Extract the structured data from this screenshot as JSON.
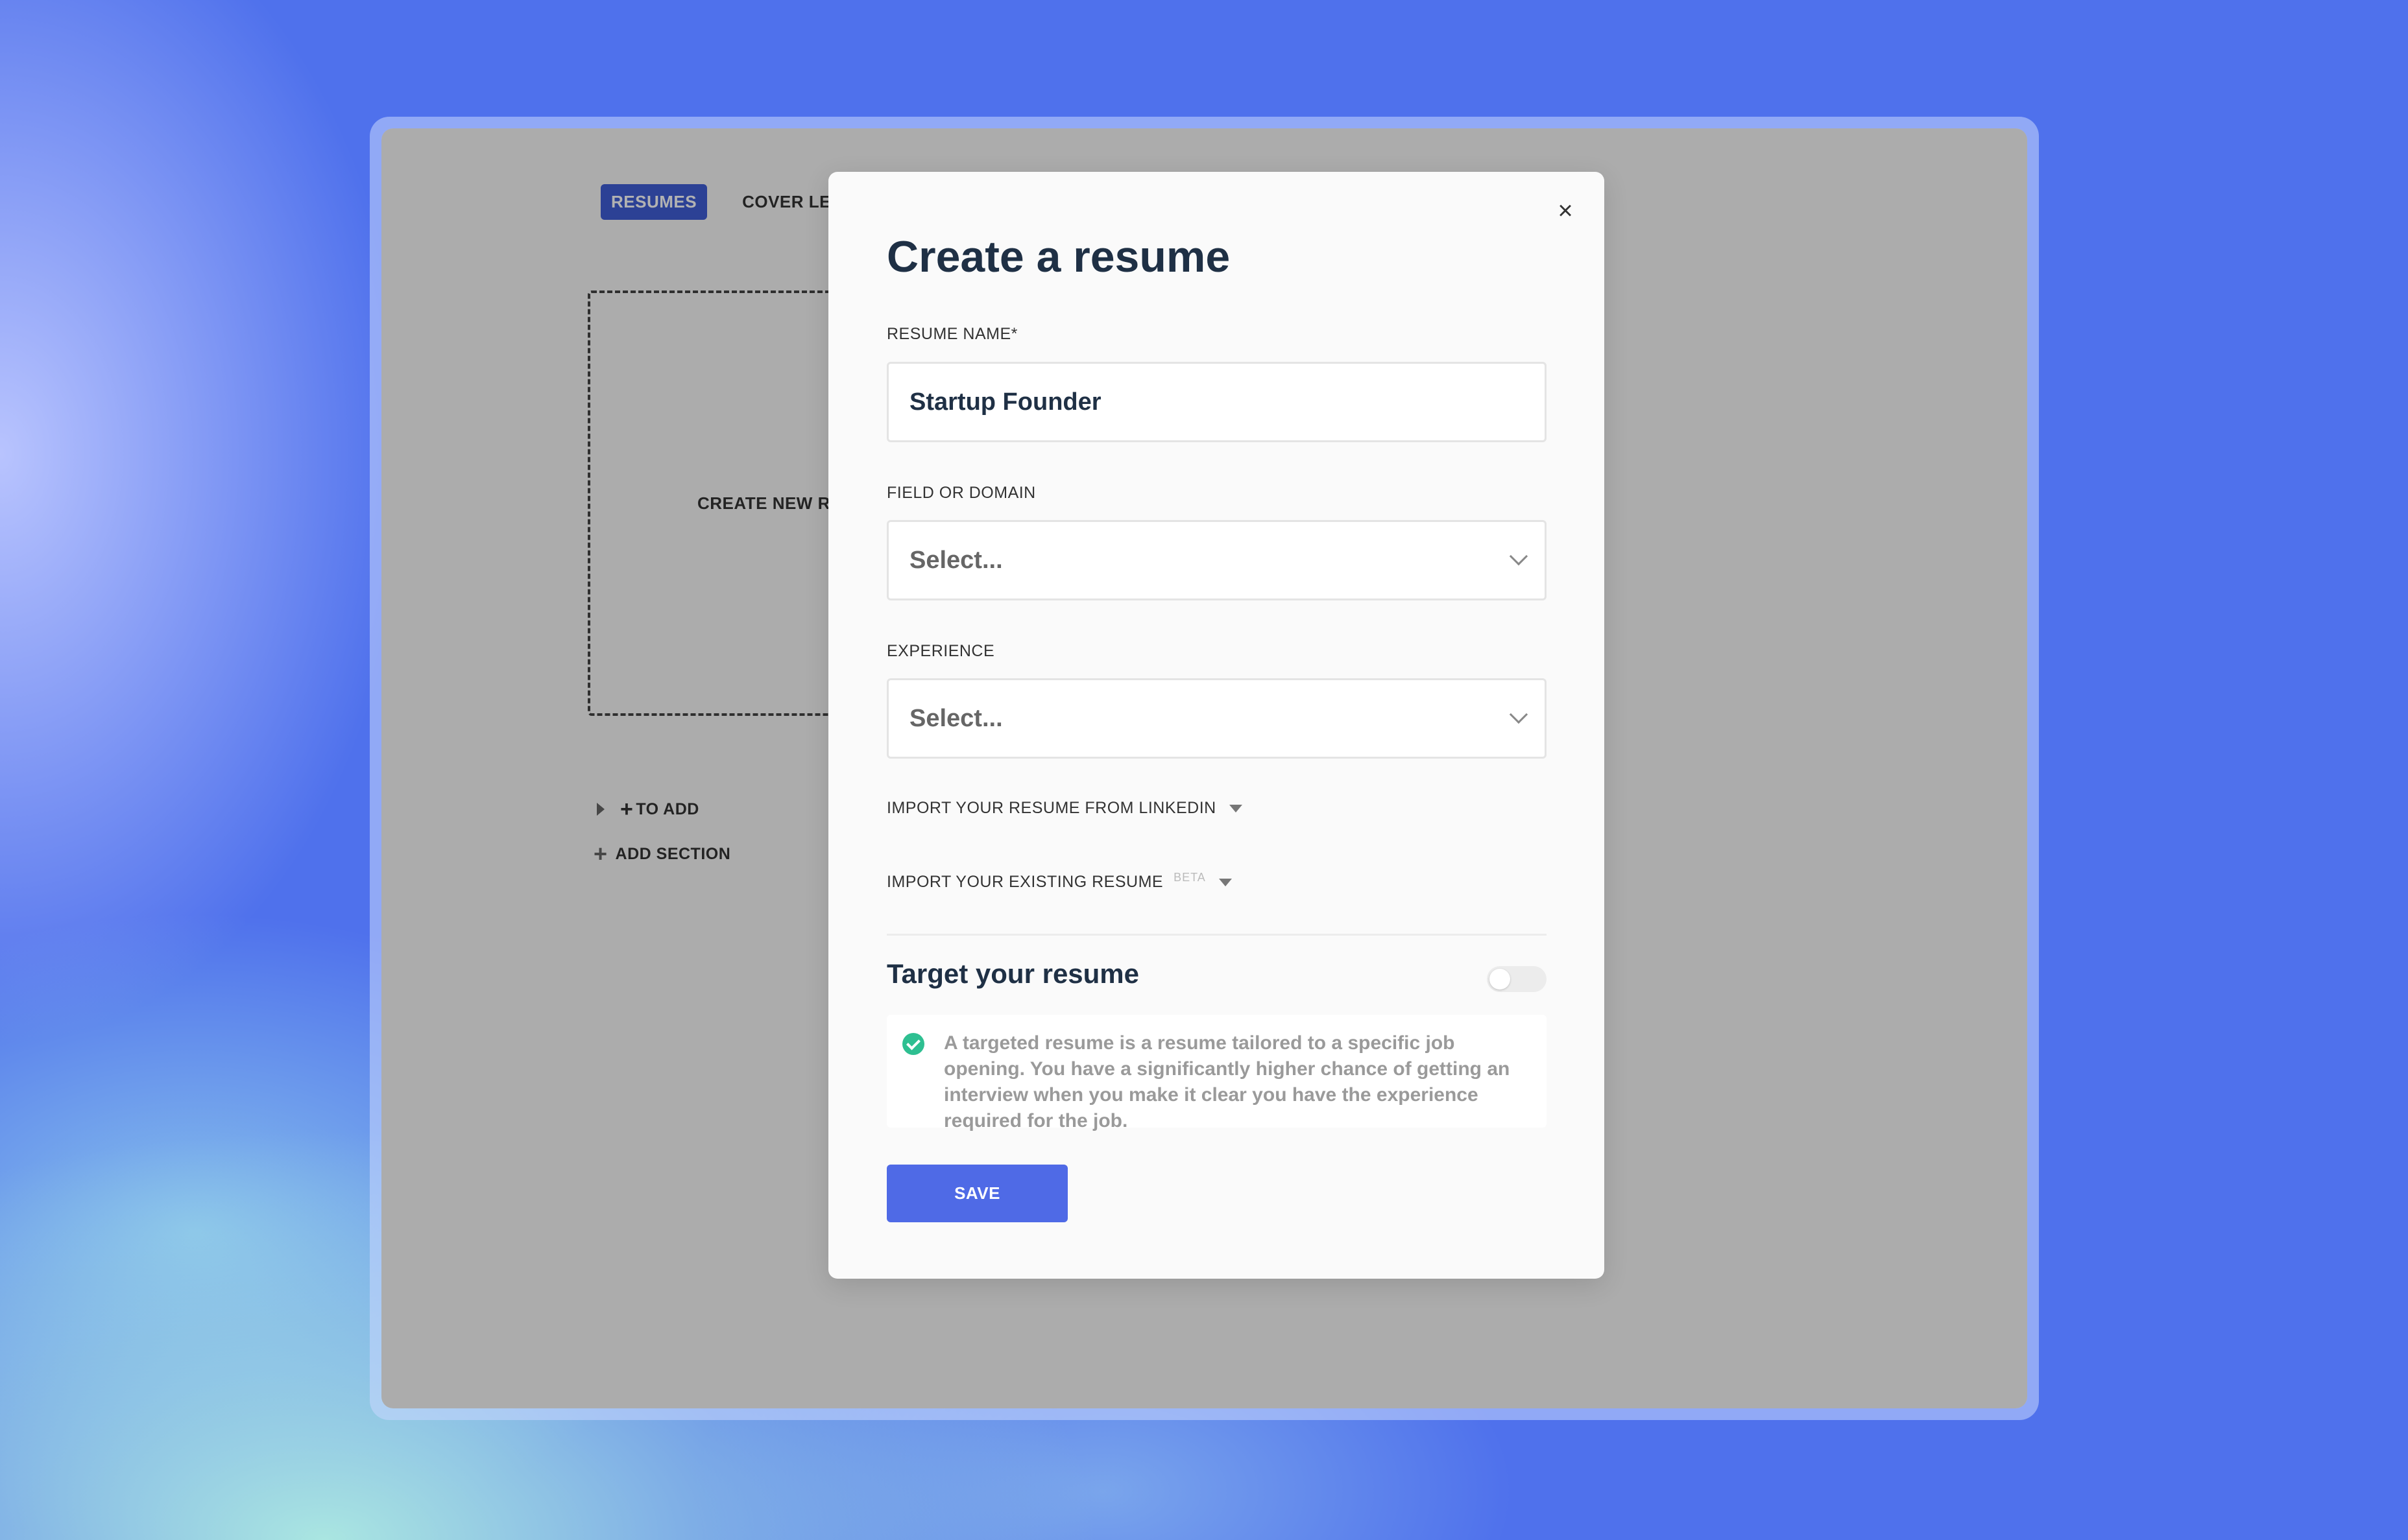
{
  "background": {
    "tabs": {
      "active": "RESUMES",
      "other": "COVER LETT"
    },
    "create_card_label": "CREATE NEW RES",
    "list_items": {
      "to_add": "TO ADD",
      "add_section": "ADD SECTION"
    }
  },
  "modal": {
    "title": "Create a resume",
    "close_icon": "×",
    "resume_name": {
      "label": "RESUME NAME*",
      "value": "Startup Founder"
    },
    "field_or_domain": {
      "label": "FIELD OR DOMAIN",
      "value": "Select..."
    },
    "experience": {
      "label": "EXPERIENCE",
      "value": "Select..."
    },
    "import_linkedin": "IMPORT YOUR RESUME FROM LINKEDIN",
    "import_existing": "IMPORT YOUR EXISTING RESUME",
    "beta_badge": "BETA",
    "target": {
      "title": "Target your resume",
      "toggle_on": false,
      "info_text": "A targeted resume is a resume tailored to a specific job opening. You have a significantly higher chance of getting an interview when you make it clear you have the experience required for the job."
    },
    "save_label": "SAVE"
  },
  "colors": {
    "accent": "#4f6ae6",
    "title_text": "#1f3045",
    "success": "#2ebf91"
  },
  "icons": {
    "close": "close-icon",
    "chevron": "chevron-down-icon",
    "check": "check-circle-icon"
  }
}
